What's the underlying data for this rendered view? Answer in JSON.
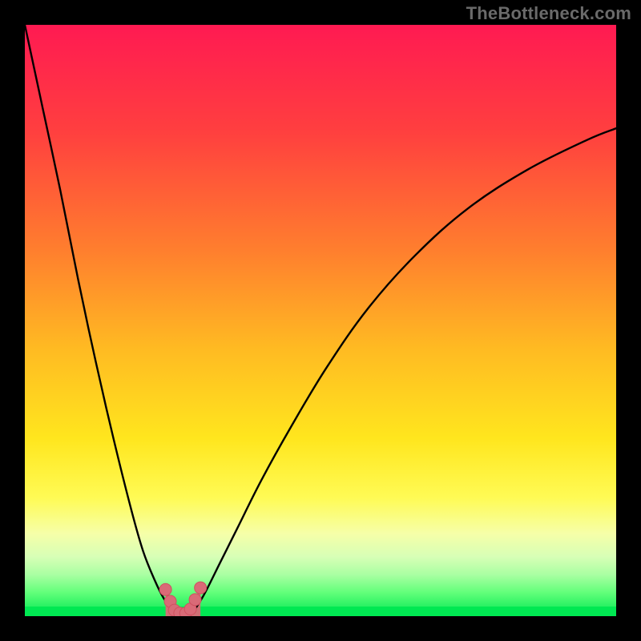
{
  "watermark": "TheBottleneck.com",
  "colors": {
    "frame": "#000000",
    "curve": "#000000",
    "marker_fill": "#d96a77",
    "marker_stroke": "#cf5060",
    "green_band": "#00e852"
  },
  "chart_data": {
    "type": "line",
    "title": "",
    "xlabel": "",
    "ylabel": "",
    "xlim": [
      0,
      100
    ],
    "ylim": [
      0,
      100
    ],
    "grid": false,
    "legend": false,
    "series": [
      {
        "name": "left-branch",
        "x": [
          0,
          3,
          6,
          9,
          12,
          15,
          18,
          20,
          22,
          23.5,
          25,
          25.8
        ],
        "y": [
          100,
          86,
          72,
          57,
          43,
          30,
          18,
          11,
          6,
          3,
          1,
          0
        ]
      },
      {
        "name": "right-branch",
        "x": [
          27.8,
          29,
          30.5,
          33,
          36,
          40,
          45,
          51,
          58,
          66,
          75,
          85,
          95,
          100
        ],
        "y": [
          0,
          1.5,
          4,
          9,
          15,
          23,
          32,
          42,
          52,
          61,
          69,
          75.5,
          80.5,
          82.5
        ]
      }
    ],
    "markers": {
      "name": "valley-markers",
      "points": [
        {
          "x": 23.8,
          "y": 4.5
        },
        {
          "x": 24.6,
          "y": 2.5
        },
        {
          "x": 25.3,
          "y": 1.0
        },
        {
          "x": 26.2,
          "y": 0.5
        },
        {
          "x": 27.2,
          "y": 0.5
        },
        {
          "x": 28.0,
          "y": 1.2
        },
        {
          "x": 28.8,
          "y": 2.8
        },
        {
          "x": 29.7,
          "y": 4.8
        }
      ]
    },
    "valley_fill": {
      "from_x": 23.8,
      "to_x": 29.7,
      "to_y_top": 6
    },
    "gradient_stops": [
      {
        "offset": 0,
        "color": "#ff1a52"
      },
      {
        "offset": 18,
        "color": "#ff3f3f"
      },
      {
        "offset": 38,
        "color": "#ff7e2e"
      },
      {
        "offset": 55,
        "color": "#ffbb22"
      },
      {
        "offset": 70,
        "color": "#ffe61e"
      },
      {
        "offset": 80,
        "color": "#fffb55"
      },
      {
        "offset": 86,
        "color": "#f6ffa8"
      },
      {
        "offset": 90,
        "color": "#d7ffb6"
      },
      {
        "offset": 93,
        "color": "#a9ffa2"
      },
      {
        "offset": 96,
        "color": "#62ff7a"
      },
      {
        "offset": 100,
        "color": "#00e852"
      }
    ]
  }
}
